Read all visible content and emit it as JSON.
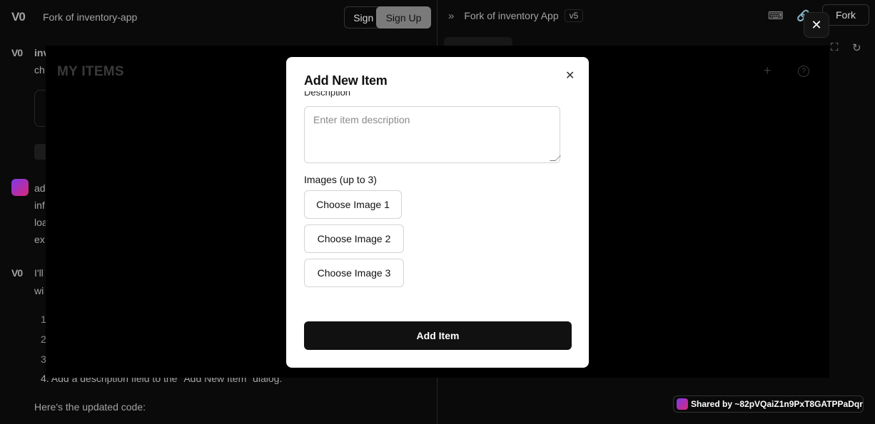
{
  "left": {
    "logo": "V0",
    "project_title": "Fork of inventory-app",
    "signin_label": "Sign In",
    "signup_label": "Sign Up",
    "chat": [
      {
        "text": "inv"
      },
      {
        "text": "ch"
      },
      {
        "text": "ad"
      },
      {
        "text": "inf"
      },
      {
        "text": "loa"
      },
      {
        "text": "ex"
      },
      {
        "text": "I'll"
      },
      {
        "text": "wi"
      }
    ],
    "list_numbers": [
      "1",
      "2",
      "3"
    ],
    "step4": "4.  Add a description field to the \"Add New Item\" dialog.",
    "heres": "Here's the updated code:"
  },
  "right": {
    "title": "Fork of inventory App",
    "version": "v5",
    "fork_label": "Fork",
    "my_items": "MY ITEMS"
  },
  "dialog": {
    "title": "Add New Item",
    "cut_label": "Description",
    "description_placeholder": "Enter item description",
    "images_label": "Images (up to 3)",
    "choose1": "Choose Image 1",
    "choose2": "Choose Image 2",
    "choose3": "Choose Image 3",
    "submit": "Add Item"
  },
  "shared": {
    "label": "Shared by ~82pVQaiZ1n9PxT8GATPPaDqr"
  },
  "colors": {
    "dialog_bg": "#ffffff",
    "primary": "#111111",
    "app_bg": "#0a0a0a"
  }
}
